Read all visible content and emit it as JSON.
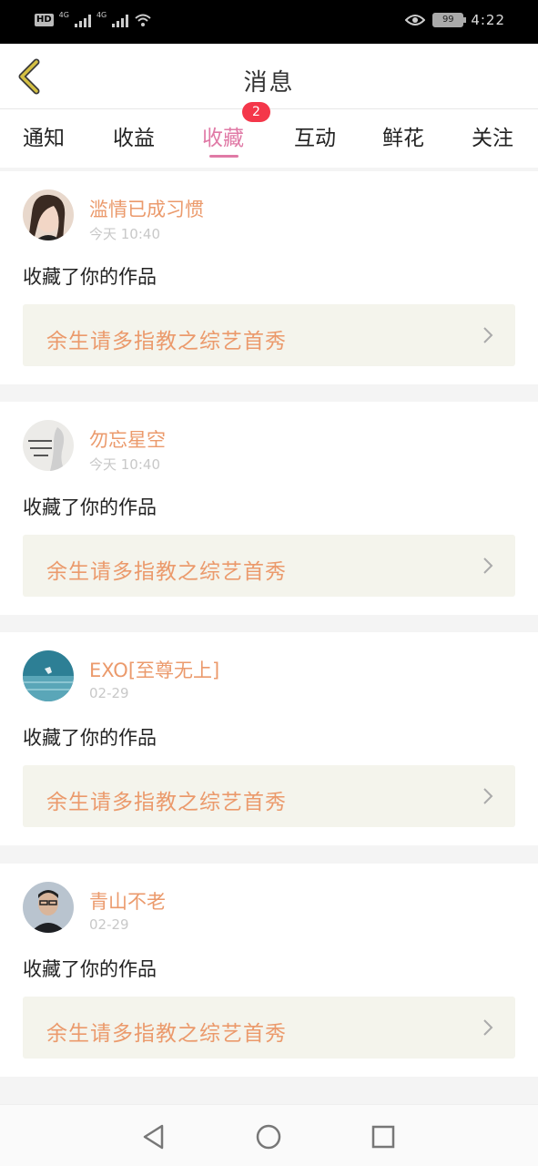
{
  "status_bar": {
    "hd_label": "HD",
    "network_1": "4G",
    "network_2": "4G",
    "battery": "99",
    "time": "4:22",
    "icons": [
      "signal-icon",
      "wifi-icon",
      "eye-icon",
      "battery-icon"
    ]
  },
  "header": {
    "title": "消息",
    "back_icon": "back-chevron-icon"
  },
  "tabs": {
    "items": [
      {
        "label": "通知"
      },
      {
        "label": "收益"
      },
      {
        "label": "收藏"
      },
      {
        "label": "互动"
      },
      {
        "label": "鲜花"
      },
      {
        "label": "关注"
      }
    ],
    "active_index": 2,
    "badge": "2"
  },
  "messages": [
    {
      "user": "滥情已成习惯",
      "time": "今天 10:40",
      "action": "收藏了你的作品",
      "work": "余生请多指教之综艺首秀"
    },
    {
      "user": "勿忘星空",
      "time": "今天 10:40",
      "action": "收藏了你的作品",
      "work": "余生请多指教之综艺首秀"
    },
    {
      "user": "EXO[至尊无上]",
      "time": "02-29",
      "action": "收藏了你的作品",
      "work": "余生请多指教之综艺首秀"
    },
    {
      "user": "青山不老",
      "time": "02-29",
      "action": "收藏了你的作品",
      "work": "余生请多指教之综艺首秀"
    }
  ],
  "colors": {
    "accent": "#e07aa6",
    "name": "#eb9a6c",
    "badge": "#f4374a",
    "back_icon": "#c9b43a"
  },
  "navbar": {
    "icons": [
      "nav-back-icon",
      "nav-home-icon",
      "nav-recents-icon"
    ]
  }
}
